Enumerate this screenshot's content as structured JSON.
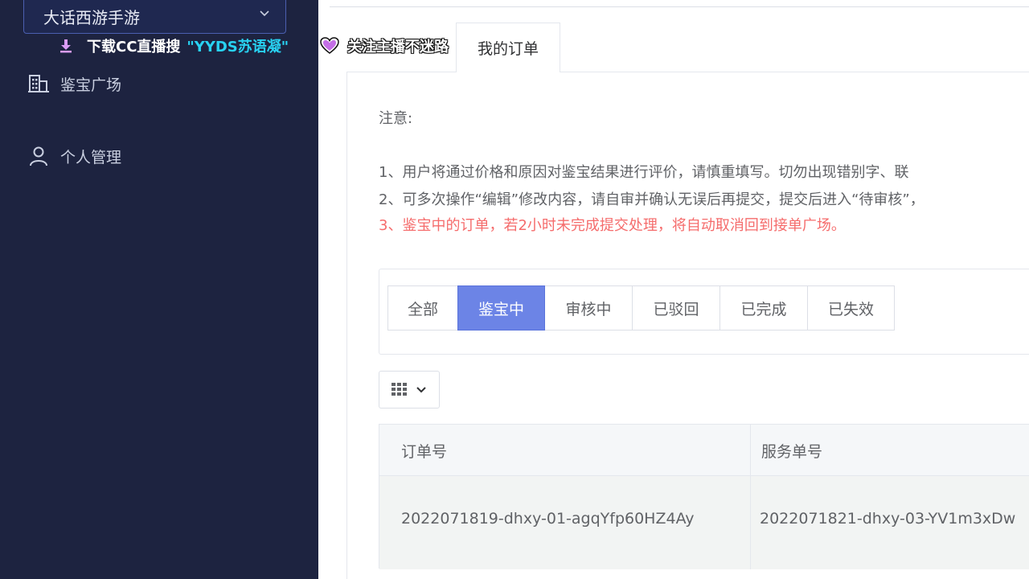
{
  "sidebar": {
    "game_select": "大话西游手游",
    "download_text": "下载CC直播搜",
    "download_name": "\"YYDS苏语凝\"",
    "menu": [
      {
        "label": "鉴宝广场",
        "icon": "building-icon"
      },
      {
        "label": "个人管理",
        "icon": "user-icon"
      }
    ]
  },
  "overlay": {
    "follow_text": "关注主播不迷路"
  },
  "tab": {
    "label": "我的订单"
  },
  "notice": {
    "title": "注意:",
    "line1": "1、用户将通过价格和原因对鉴宝结果进行评价，请慎重填写。切勿出现错别字、联",
    "line2": "2、可多次操作“编辑”修改内容，请自审并确认无误后再提交，提交后进入“待审核”，",
    "line3": "3、鉴宝中的订单，若2小时未完成提交处理，将自动取消回到接单广场。"
  },
  "filters": [
    {
      "label": "全部",
      "active": false
    },
    {
      "label": "鉴宝中",
      "active": true
    },
    {
      "label": "审核中",
      "active": false
    },
    {
      "label": "已驳回",
      "active": false
    },
    {
      "label": "已完成",
      "active": false
    },
    {
      "label": "已失效",
      "active": false
    }
  ],
  "table": {
    "headers": [
      "订单号",
      "服务单号"
    ],
    "rows": [
      [
        "2022071819-dhxy-01-agqYfp60HZ4Ay",
        "2022071821-dhxy-03-YV1m3xDw"
      ]
    ]
  },
  "colors": {
    "sidebar_bg": "#1d2340",
    "accent": "#6c84e6",
    "warning_text": "#f56c6c",
    "highlight_name": "#28d2f2"
  }
}
